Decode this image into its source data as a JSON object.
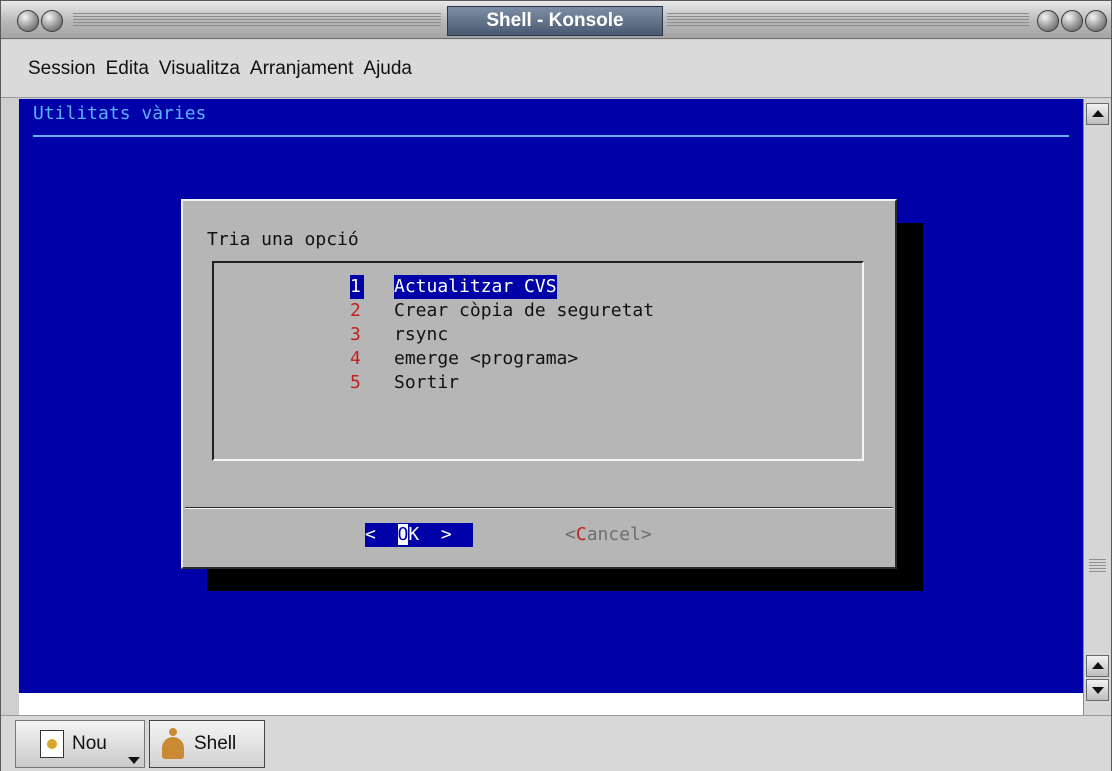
{
  "window": {
    "title": "Shell - Konsole"
  },
  "menubar": {
    "items": [
      "Session",
      "Edita",
      "Visualitza",
      "Arranjament",
      "Ajuda"
    ]
  },
  "terminal": {
    "header": "Utilitats vàries",
    "background_color": "#0000a8",
    "dialog": {
      "prompt": "Tria una opció",
      "options": [
        {
          "num": "1",
          "label": "Actualitzar CVS",
          "selected": true
        },
        {
          "num": "2",
          "label": "Crear còpia de seguretat",
          "selected": false
        },
        {
          "num": "3",
          "label": "rsync",
          "selected": false
        },
        {
          "num": "4",
          "label": "emerge <programa>",
          "selected": false
        },
        {
          "num": "5",
          "label": "Sortir",
          "selected": false
        }
      ],
      "ok": {
        "before": "<  ",
        "hotkey": "O",
        "after": "K  >"
      },
      "cancel": {
        "before": "<",
        "hotkey": "C",
        "after": "ancel>"
      }
    }
  },
  "tabbar": {
    "new_label": "Nou",
    "new_icon": "new-session-icon",
    "shell_label": "Shell",
    "shell_icon": "shell-icon"
  }
}
